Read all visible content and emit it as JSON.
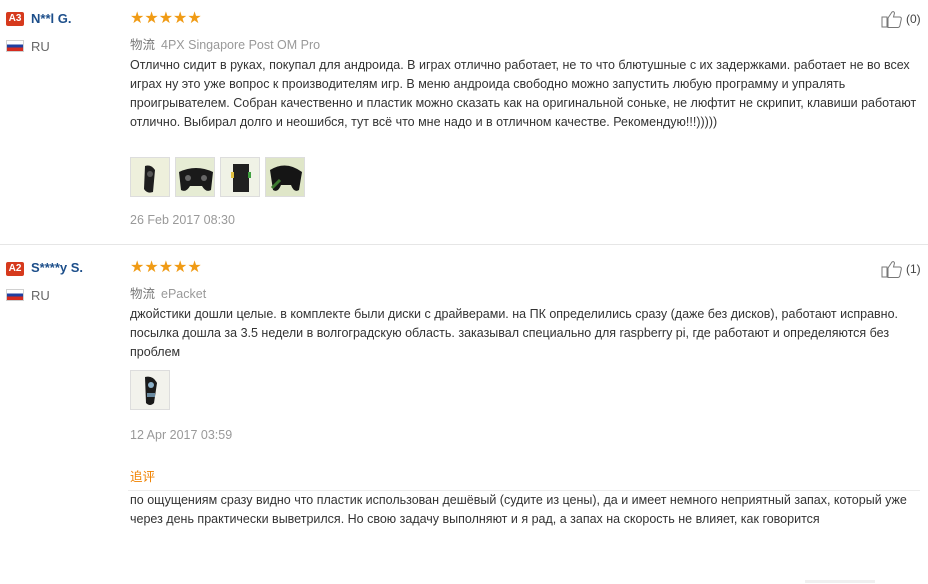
{
  "reviews": [
    {
      "level": "A3",
      "user": "N**l G.",
      "country": "RU",
      "rating": 5,
      "stars": "★★★★★",
      "logistics_label": "物流",
      "logistics": "4PX Singapore Post OM Pro",
      "text": "Отлично сидит в руках, покупал для андроида. В играх отлично работает, не то что блютушные с их задержками. работает не во всех играх ну это уже вопрос к производителям игр. В меню андроида свободно можно запустить любую программу и упралять проигрывателем. Собран качественно и пластик можно сказать как на оригинальной соньке, не люфтит не скрипит, клавиши работают отлично. Выбирал долго и неошибся, тут всё что мне надо и в отличном качестве. Рекомендую!!!)))))",
      "helpful": "(0)",
      "photo_count": 4,
      "date": "26 Feb 2017 08:30"
    },
    {
      "level": "A2",
      "user": "S****y S.",
      "country": "RU",
      "rating": 5,
      "stars": "★★★★★",
      "logistics_label": "物流",
      "logistics": "ePacket",
      "text": "джойстики дошли целые. в комплекте были диски с драйверами. на ПК определились сразу (даже без дисков), работают исправно. посылка дошла за 3.5 недели в волгоградскую область. заказывал специально для raspberry pi, где работают и определяются без проблем",
      "helpful": "(1)",
      "photo_count": 1,
      "date": "12 Apr 2017 03:59",
      "followup_label": "追评",
      "followup_text": "по ощущениям сразу видно что пластик использован дешёвый (судите из цены), да и имеет немного неприятный запах, который уже через день практически выветрился. Но свою задачу выполняют и я рад, а запах на скорость не влияет, как говорится"
    }
  ],
  "icons": {
    "thumb": "thumbs-up-icon",
    "flag": "russia-flag-icon"
  },
  "colors": {
    "stars": "#f09b15",
    "badge": "#d63a1d",
    "username": "#1c4e8a",
    "followup": "#f08200"
  }
}
